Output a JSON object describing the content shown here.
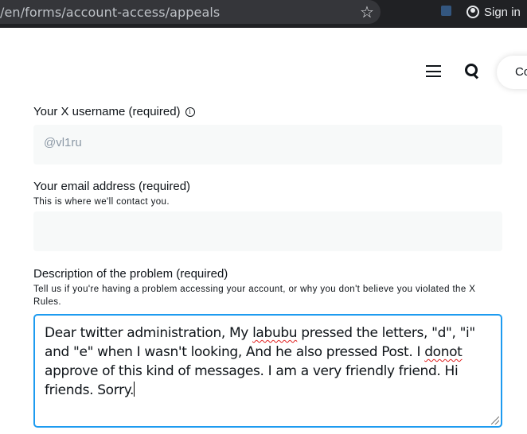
{
  "browser": {
    "url": "/en/forms/account-access/appeals",
    "sign_in_label": "Sign in"
  },
  "header": {
    "corner_button_label": "Co"
  },
  "form": {
    "username": {
      "label": "Your X username (required)",
      "info_glyph": "i",
      "value": "@vl1ru"
    },
    "email": {
      "label": "Your email address (required)",
      "help": "This is where we'll contact you.",
      "value": ""
    },
    "description": {
      "label": "Description of the problem (required)",
      "help": "Tell us if you're having a problem accessing your account, or why you don't believe you violated the X Rules.",
      "value_parts": {
        "a": "Dear twitter administration, My ",
        "b": "labubu",
        "c": " pressed the letters, \"d\", \"i\" and \"e\" when I wasn't looking, And he also pressed Post. I ",
        "d": "donot",
        "e": " approve of this kind of messages. I am a very friendly friend. Hi friends. Sorry."
      }
    }
  }
}
